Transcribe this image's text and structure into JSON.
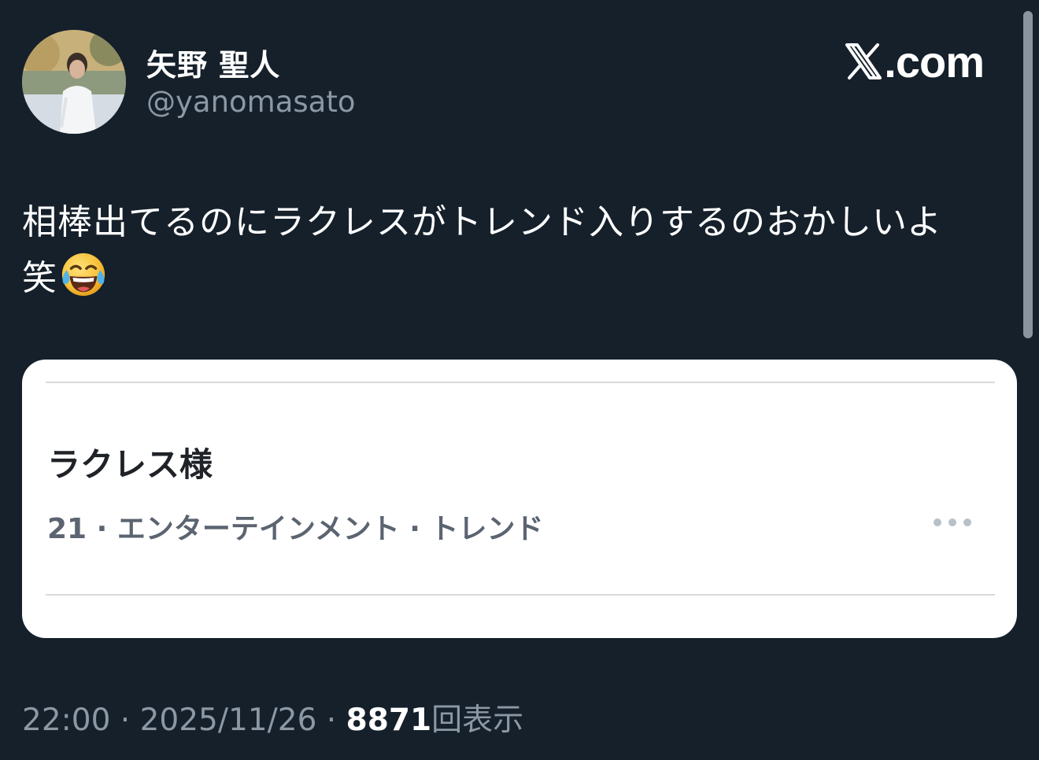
{
  "tweet": {
    "author": {
      "display_name": "矢野 聖人",
      "handle": "@yanomasato"
    },
    "brand": {
      "text": ".com",
      "icon": "x-logo-icon"
    },
    "text_line1": "相棒出てるのにラクレスがトレンド入りするのおかしいよ",
    "text_line2": "笑",
    "emoji": "face-with-tears-of-joy-icon",
    "attachment": {
      "trend_title": "ラクレス様",
      "trend_meta": "21 · エンターテインメント · トレンド",
      "more_icon": "more-dots-icon"
    },
    "footer": {
      "time": "22:00",
      "separator": " · ",
      "date": "2025/11/26",
      "views_count": "8871",
      "views_label": "回表示"
    }
  },
  "colors": {
    "background": "#15202b",
    "secondary_text": "#8b98a5",
    "card_background": "#ffffff"
  }
}
